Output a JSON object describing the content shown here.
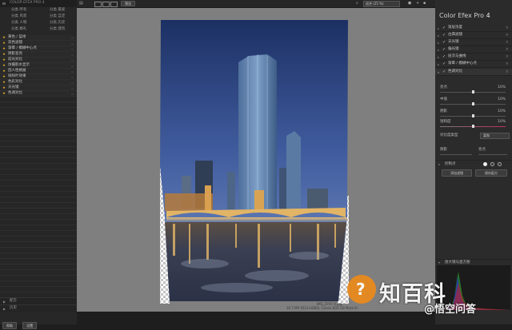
{
  "left_panel": {
    "title": "COLOR EFEX PRO 4",
    "presets": [
      "分类 所有",
      "分类 最爱",
      "分类 风景",
      "分类 自定",
      "分类 人物",
      "分类 历史",
      "分类 婚礼",
      "分类 建筑"
    ],
    "filters": [
      "黄色 / 蓝绿",
      "双色滤镜",
      "渐晕 / 模糊中心点",
      "阴影变亮",
      "前光对比",
      "仿摄影水显示",
      "因人性格展",
      "缤纷叶效果",
      "色彩对比",
      "天光镜",
      "色调对比"
    ],
    "bottom_sections": [
      "配方",
      "历史"
    ],
    "buttons": [
      "帮助",
      "设置"
    ]
  },
  "toolbar": {
    "compare_label": "预览",
    "zoom_value": "适合 (25 %)"
  },
  "status": {
    "filename": "IMG_2747-4.jpg",
    "info": "30.7 MP 4512×6800, Canon EOS 5D Mark III"
  },
  "right_panel": {
    "title_prefix": "Color Efex Pro",
    "title_version": "4",
    "filter_stack": [
      "渐层浓度",
      "古典滤镜",
      "天光镜",
      "偏光镜",
      "层次与曲线",
      "渐晕 / 模糊中心点",
      "色调对比"
    ],
    "sliders": [
      {
        "label": "亮点",
        "value": "10%",
        "level": 0.5
      },
      {
        "label": "中值",
        "value": "10%",
        "level": 0.5
      },
      {
        "label": "阴影",
        "value": "10%",
        "level": 0.5
      },
      {
        "label": "饱和度",
        "value": "10%",
        "level": 0.5
      }
    ],
    "contrast_type_label": "对比度类型",
    "contrast_type_value": "柔和",
    "shadows_label": "阴影",
    "highlights_label": "亮点",
    "control_points_label": "控制点",
    "add_filter_button": "添加滤镜",
    "save_preset_button": "保存配方",
    "histogram_label": "放大镜与直方图"
  },
  "watermark": {
    "brand_text": "知百科",
    "sub_text": "@悟空问答"
  },
  "colors": {
    "accent": "#d4a52a",
    "sky_top": "#1c3063",
    "sky_bottom": "#7892c6"
  }
}
